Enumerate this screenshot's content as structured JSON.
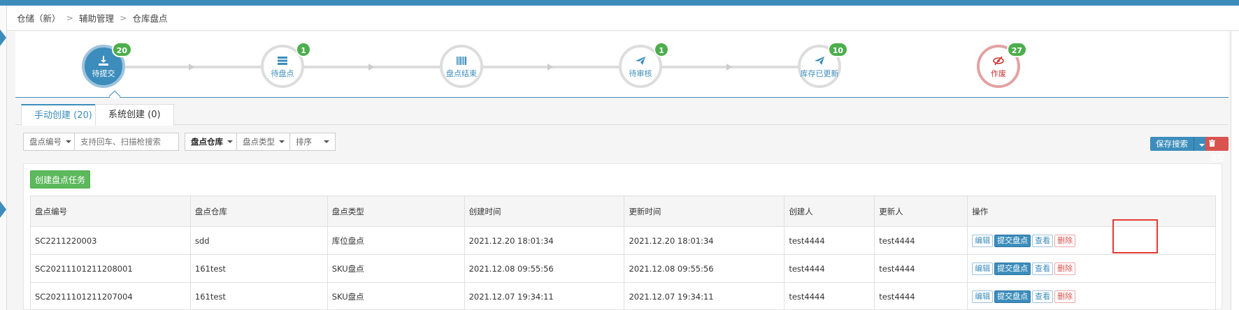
{
  "breadcrumb": [
    "仓储（新）",
    "辅助管理",
    "仓库盘点"
  ],
  "steps": [
    {
      "label": "待提交",
      "badge": "20",
      "icon": "download-icon",
      "state": "active"
    },
    {
      "label": "待盘点",
      "badge": "1",
      "icon": "stack-icon",
      "state": "normal"
    },
    {
      "label": "盘点结束",
      "badge": "",
      "icon": "barcode-icon",
      "state": "normal"
    },
    {
      "label": "待审核",
      "badge": "1",
      "icon": "paper-plane-icon",
      "state": "normal"
    },
    {
      "label": "库存已更新",
      "badge": "10",
      "icon": "paper-plane-icon",
      "state": "normal"
    },
    {
      "label": "作废",
      "badge": "27",
      "icon": "eye-slash-icon",
      "state": "danger"
    }
  ],
  "tabs": [
    {
      "label": "手动创建 (20)",
      "active": true
    },
    {
      "label": "系统创建 (0)",
      "active": false
    }
  ],
  "filters": {
    "code": "盘点编号",
    "search_placeholder": "支持回车、扫描枪搜索",
    "warehouse": "盘点仓库",
    "type": "盘点类型",
    "sort": "排序"
  },
  "save_search": "保存搜索",
  "clear": "清空",
  "create_button": "创建盘点任务",
  "table": {
    "headers": [
      "盘点编号",
      "盘点仓库",
      "盘点类型",
      "创建时间",
      "更新时间",
      "创建人",
      "更新人",
      "操作"
    ],
    "rows": [
      [
        "SC2211220003",
        "sdd",
        "库位盘点",
        "2021.12.20 18:01:34",
        "2021.12.20 18:01:34",
        "test4444",
        "test4444"
      ],
      [
        "SC20211101211208001",
        "161test",
        "SKU盘点",
        "2021.12.08 09:55:56",
        "2021.12.08 09:55:56",
        "test4444",
        "test4444"
      ],
      [
        "SC20211101211207004",
        "161test",
        "SKU盘点",
        "2021.12.07 19:34:11",
        "2021.12.07 19:34:11",
        "test4444",
        "test4444"
      ]
    ],
    "actions": [
      "编辑",
      "提交盘点",
      "查看",
      "删除"
    ]
  },
  "colors": {
    "primary": "#3c8dbc",
    "success": "#5cb85c",
    "danger": "#d9534f",
    "highlight": "#e53935"
  }
}
